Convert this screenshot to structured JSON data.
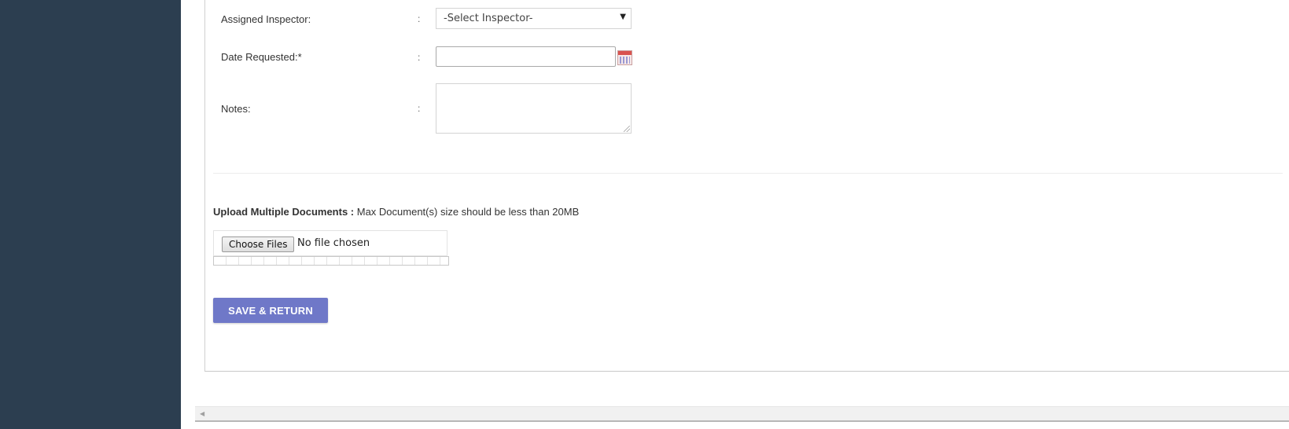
{
  "form": {
    "assigned_inspector": {
      "label": "Assigned Inspector:",
      "colon": ":",
      "selected": "-Select Inspector-"
    },
    "date_requested": {
      "label": "Date Requested:*",
      "colon": ":",
      "value": ""
    },
    "notes": {
      "label": "Notes:",
      "colon": ":",
      "value": ""
    }
  },
  "upload": {
    "heading_bold": "Upload Multiple Documents :",
    "heading_note": "Max Document(s) size should be less than 20MB",
    "choose_label": "Choose Files",
    "no_file_text": "No file chosen"
  },
  "actions": {
    "save_return_label": "SAVE & RETURN"
  },
  "icons": {
    "calendar": "calendar-icon",
    "caret": "caret-down-icon",
    "scroll_left": "scroll-left-arrow-icon"
  },
  "colors": {
    "sidebar": "#2c3e50",
    "primary_button": "#6f78c8",
    "calendar_accent": "#d9534f"
  }
}
